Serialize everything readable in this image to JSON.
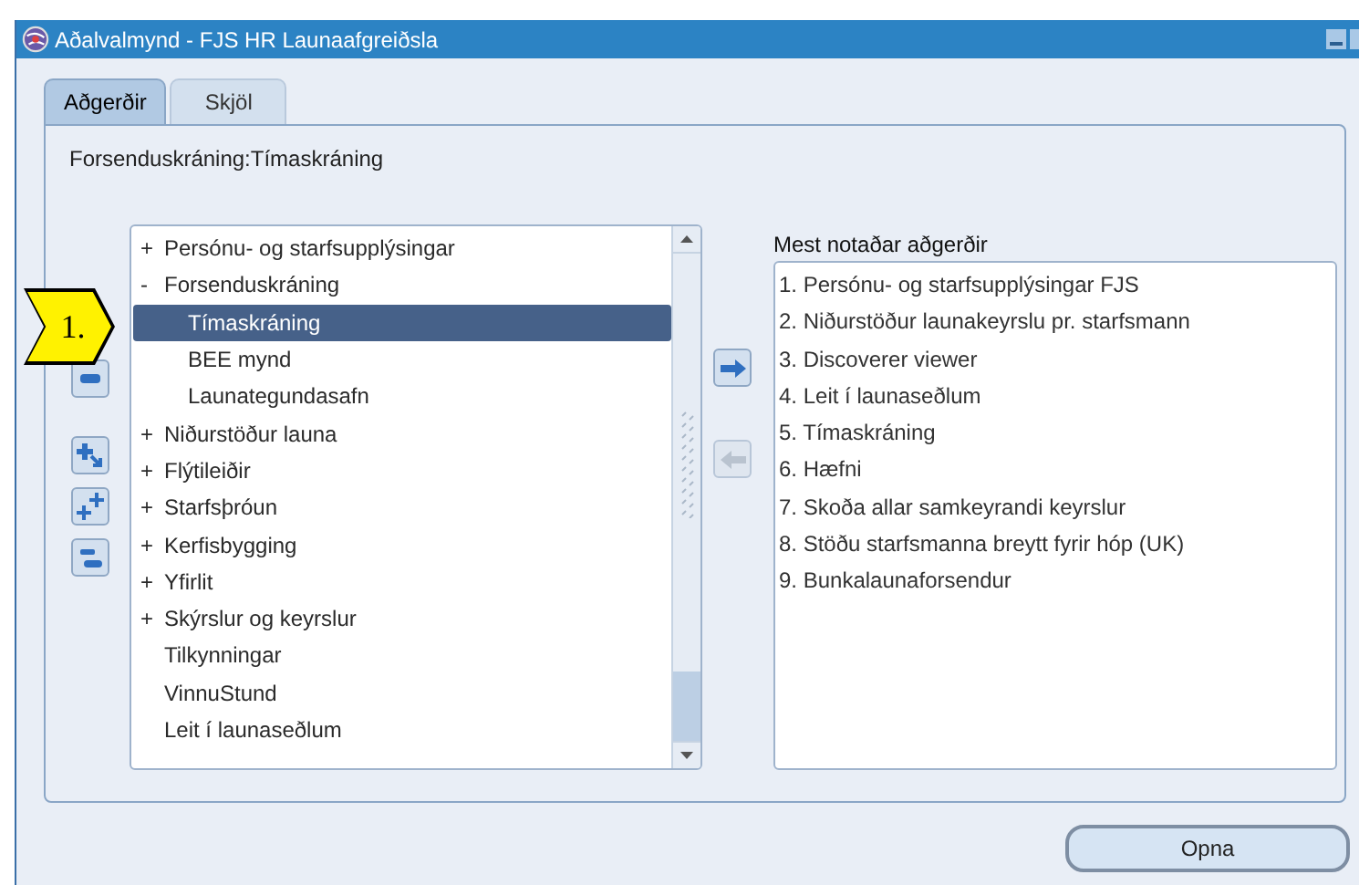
{
  "window": {
    "title": "Aðalvalmynd - FJS HR Launaafgreiðsla"
  },
  "tabs": [
    {
      "label": "Aðgerðir",
      "selected": true
    },
    {
      "label": "Skjöl",
      "selected": false
    }
  ],
  "breadcrumb": "Forsenduskráning:Tímaskráning",
  "callout": {
    "label": "1."
  },
  "tree": {
    "items": [
      {
        "marker": "+",
        "label": "Persónu- og starfsupplýsingar",
        "selected": false
      },
      {
        "marker": "-",
        "label": "Forsenduskráning",
        "selected": false,
        "children": [
          {
            "label": "Tímaskráning",
            "selected": true
          },
          {
            "label": "BEE mynd",
            "selected": false
          },
          {
            "label": "Launategundasafn",
            "selected": false
          }
        ]
      },
      {
        "marker": "+",
        "label": "Niðurstöður launa",
        "selected": false
      },
      {
        "marker": "+",
        "label": "Flýtileiðir",
        "selected": false
      },
      {
        "marker": "+",
        "label": "Starfsþróun",
        "selected": false
      },
      {
        "marker": "+",
        "label": "Kerfisbygging",
        "selected": false
      },
      {
        "marker": "+",
        "label": "Yfirlit",
        "selected": false
      },
      {
        "marker": "+",
        "label": "Skýrslur og keyrslur",
        "selected": false
      },
      {
        "label": "Tilkynningar",
        "selected": false
      },
      {
        "label": "VinnuStund",
        "selected": false
      },
      {
        "label": "Leit í launaseðlum",
        "selected": false
      }
    ]
  },
  "move_buttons": [
    {
      "kind": "add",
      "disabled": false
    },
    {
      "kind": "remove",
      "disabled": true
    }
  ],
  "favorites": {
    "title": "Mest notaðar aðgerðir",
    "items": [
      "1. Persónu- og starfsupplýsingar FJS",
      "2. Niðurstöður launakeyrslu pr. starfsmann",
      "3. Discoverer viewer",
      "4. Leit í launaseðlum",
      "5. Tímaskráning",
      "6. Hæfni",
      "7. Skoða allar samkeyrandi keyrslur",
      "8. Stöðu starfsmanna breytt fyrir hóp (UK)",
      "9. Bunkalaunaforsendur"
    ]
  },
  "buttons": [
    {
      "label": "Opna"
    }
  ]
}
